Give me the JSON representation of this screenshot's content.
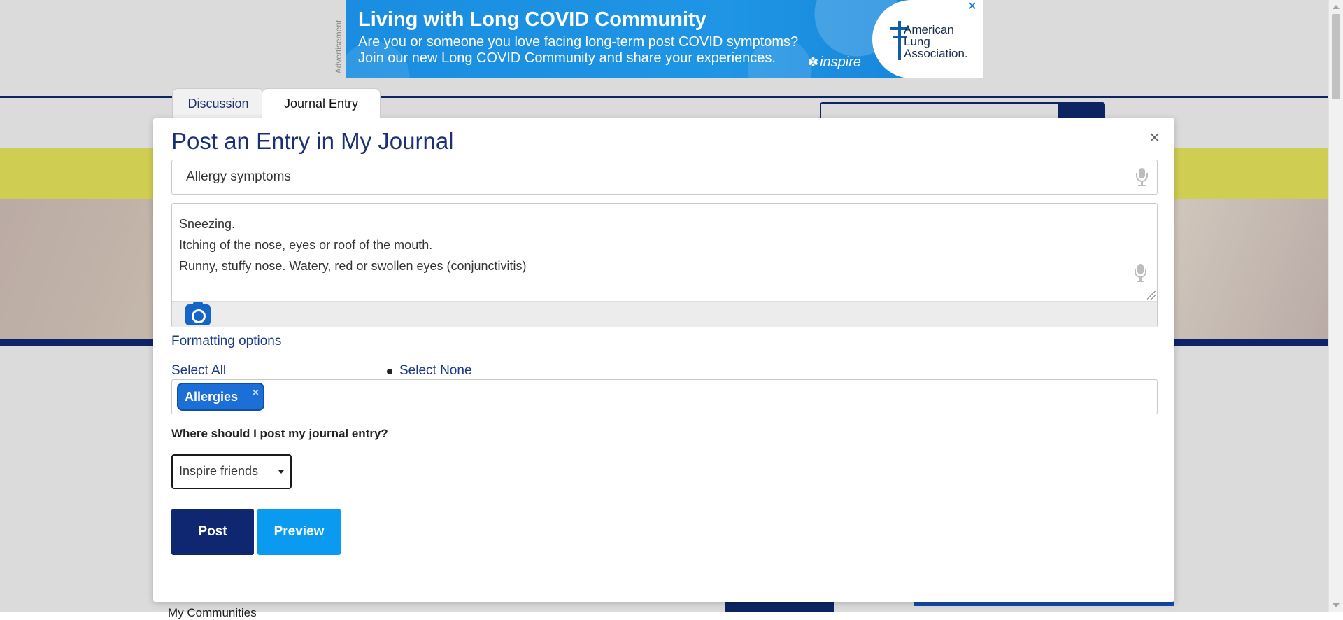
{
  "advertisement": {
    "label": "Advertisement",
    "title": "Living with Long COVID Community",
    "line1": "Are you or someone you love facing long-term post COVID symptoms?",
    "line2": "Join our new Long COVID Community and share your experiences.",
    "brand": "inspire",
    "close": "✕",
    "org_line1": "American",
    "org_line2": "Lung",
    "org_line3": "Association."
  },
  "background": {
    "sidebar_text": "My Communities"
  },
  "tabs": [
    {
      "label": "Discussion"
    },
    {
      "label": "Journal Entry"
    }
  ],
  "modal": {
    "title": "Post an Entry in My Journal",
    "close": "×",
    "entry_title": "Allergy symptoms",
    "body_lines": [
      "Sneezing.",
      "Itching of the nose, eyes or roof of the mouth.",
      "Runny, stuffy nose. Watery, red or swollen eyes (conjunctivitis)"
    ],
    "formatting_link": "Formatting options",
    "select_all": "Select All",
    "select_none": "Select None",
    "tags": [
      {
        "label": "Allergies",
        "remove": "×"
      }
    ],
    "where_label": "Where should I post my journal entry?",
    "audience_select": "Inspire friends",
    "post_button": "Post",
    "preview_button": "Preview"
  },
  "colors": {
    "navy": "#0f2670",
    "link": "#1b3a86",
    "accent_blue": "#0a9bf0",
    "tag_blue": "#1b6fd6"
  }
}
